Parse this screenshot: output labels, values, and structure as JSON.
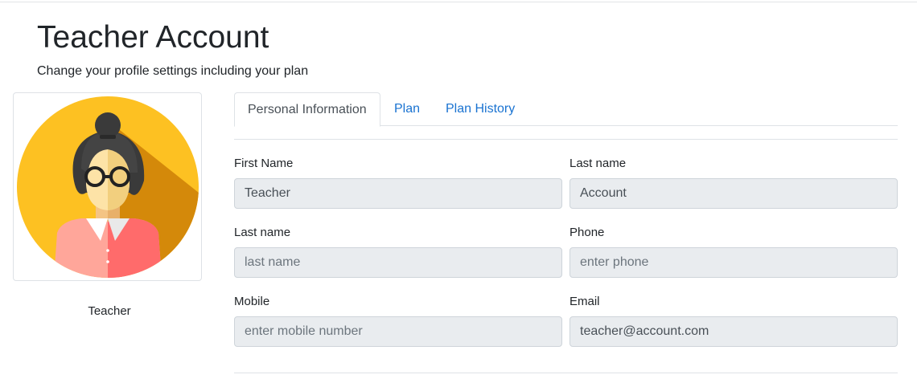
{
  "header": {
    "title": "Teacher Account",
    "subtitle": "Change your profile settings including your plan"
  },
  "profile": {
    "name": "Teacher",
    "avatar_icon": "teacher-avatar-icon"
  },
  "tabs": [
    {
      "label": "Personal Information",
      "active": true
    },
    {
      "label": "Plan",
      "active": false
    },
    {
      "label": "Plan History",
      "active": false
    }
  ],
  "form": {
    "first_name": {
      "label": "First Name",
      "value": "Teacher",
      "placeholder": ""
    },
    "last_name": {
      "label": "Last name",
      "value": "Account",
      "placeholder": ""
    },
    "last_name_2": {
      "label": "Last name",
      "value": "",
      "placeholder": "last name"
    },
    "phone": {
      "label": "Phone",
      "value": "",
      "placeholder": "enter phone"
    },
    "mobile": {
      "label": "Mobile",
      "value": "",
      "placeholder": "enter mobile number"
    },
    "email": {
      "label": "Email",
      "value": "teacher@account.com",
      "placeholder": ""
    }
  },
  "colors": {
    "link": "#1a73d1",
    "input_bg": "#e9ecef",
    "avatar_bg": "#fdc122"
  }
}
